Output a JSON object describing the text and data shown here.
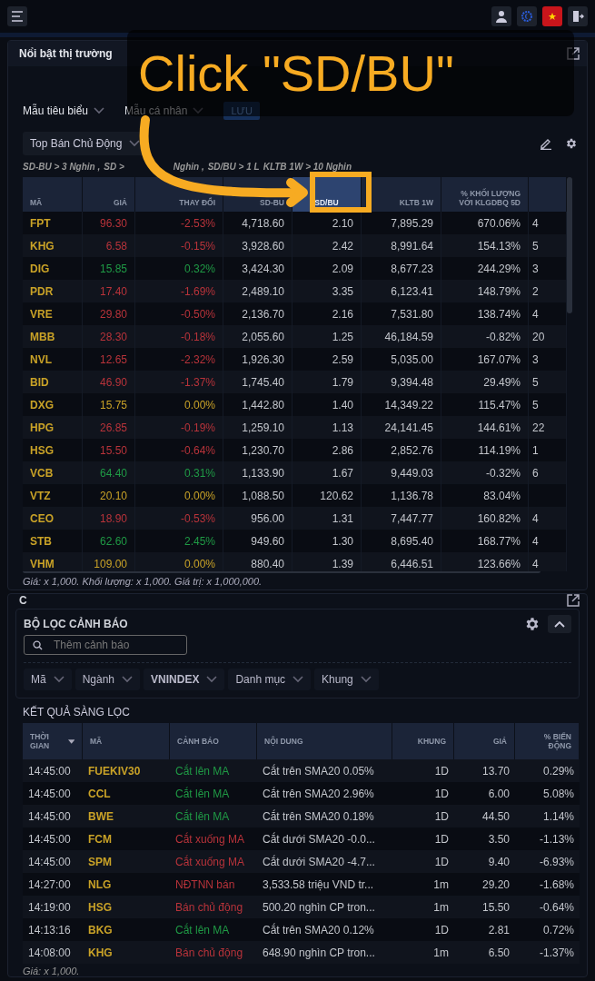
{
  "tutorial": {
    "text": "Click \"SD/BU\""
  },
  "market_panel": {
    "title": "Nổi bật thị trường",
    "templates": [
      "Mẫu tiêu biểu",
      "Mẫu cá nhân"
    ],
    "save_button": "LƯU",
    "screen_select": "Top Bán Chủ Động",
    "criteria": [
      "SD-BU > 3 Nghin ,",
      "SD >",
      "Nghin ,",
      "SD/BU > 1 L",
      "KLTB 1W > 10 Nghin"
    ],
    "columns": [
      {
        "label": "MÃ",
        "highlighted": false
      },
      {
        "label": "GIÁ",
        "highlighted": false
      },
      {
        "label": "THAY ĐỔI",
        "highlighted": false
      },
      {
        "label": "SD-BU",
        "highlighted": false
      },
      {
        "label": "SD/BU",
        "highlighted": true
      },
      {
        "label": "KLTB 1W",
        "highlighted": false
      },
      {
        "label": "% KHỐI LƯỢNG VỚI KLGDBQ 5D",
        "highlighted": false
      },
      {
        "highlighted": false
      }
    ],
    "rows": [
      {
        "symbol": "FPT",
        "price": "96.30",
        "change": "-2.53%",
        "sd_bu": "4,718.60",
        "sd_ratio": "2.10",
        "kltb_1w": "7,895.29",
        "vol_pct": "670.06%",
        "column_8": "4",
        "color": "#b8333a"
      },
      {
        "symbol": "KHG",
        "price": "6.58",
        "change": "-0.15%",
        "sd_bu": "3,928.60",
        "sd_ratio": "2.42",
        "kltb_1w": "8,991.64",
        "vol_pct": "154.13%",
        "column_8": "5",
        "color": "#b8333a"
      },
      {
        "symbol": "DIG",
        "price": "15.85",
        "change": "0.32%",
        "sd_bu": "3,424.30",
        "sd_ratio": "2.09",
        "kltb_1w": "8,677.23",
        "vol_pct": "244.29%",
        "column_8": "3",
        "color": "#1f9a45"
      },
      {
        "symbol": "PDR",
        "price": "17.40",
        "change": "-1.69%",
        "sd_bu": "2,489.10",
        "sd_ratio": "3.35",
        "kltb_1w": "6,123.41",
        "vol_pct": "148.79%",
        "column_8": "2",
        "color": "#b8333a"
      },
      {
        "symbol": "VRE",
        "price": "29.80",
        "change": "-0.50%",
        "sd_bu": "2,136.70",
        "sd_ratio": "2.16",
        "kltb_1w": "7,531.80",
        "vol_pct": "138.74%",
        "column_8": "4",
        "color": "#b8333a"
      },
      {
        "symbol": "MBB",
        "price": "28.30",
        "change": "-0.18%",
        "sd_bu": "2,055.60",
        "sd_ratio": "1.25",
        "kltb_1w": "46,184.59",
        "vol_pct": "-0.82%",
        "column_8": "20",
        "color": "#b8333a"
      },
      {
        "symbol": "NVL",
        "price": "12.65",
        "change": "-2.32%",
        "sd_bu": "1,926.30",
        "sd_ratio": "2.59",
        "kltb_1w": "5,035.00",
        "vol_pct": "167.07%",
        "column_8": "3",
        "color": "#b8333a"
      },
      {
        "symbol": "BID",
        "price": "46.90",
        "change": "-1.37%",
        "sd_bu": "1,745.40",
        "sd_ratio": "1.79",
        "kltb_1w": "9,394.48",
        "vol_pct": "29.49%",
        "column_8": "5",
        "color": "#b8333a"
      },
      {
        "symbol": "DXG",
        "price": "15.75",
        "change": "0.00%",
        "sd_bu": "1,442.80",
        "sd_ratio": "1.40",
        "kltb_1w": "14,349.22",
        "vol_pct": "115.47%",
        "column_8": "5",
        "color": "#c9a227"
      },
      {
        "symbol": "HPG",
        "price": "26.85",
        "change": "-0.19%",
        "sd_bu": "1,259.10",
        "sd_ratio": "1.13",
        "kltb_1w": "24,141.45",
        "vol_pct": "144.61%",
        "column_8": "22",
        "color": "#b8333a"
      },
      {
        "symbol": "HSG",
        "price": "15.50",
        "change": "-0.64%",
        "sd_bu": "1,230.70",
        "sd_ratio": "2.86",
        "kltb_1w": "2,852.76",
        "vol_pct": "114.19%",
        "column_8": "1",
        "color": "#b8333a"
      },
      {
        "symbol": "VCB",
        "price": "64.40",
        "change": "0.31%",
        "sd_bu": "1,133.90",
        "sd_ratio": "1.67",
        "kltb_1w": "9,449.03",
        "vol_pct": "-0.32%",
        "column_8": "6",
        "color": "#1f9a45"
      },
      {
        "symbol": "VTZ",
        "price": "20.10",
        "change": "0.00%",
        "sd_bu": "1,088.50",
        "sd_ratio": "120.62",
        "kltb_1w": "1,136.78",
        "vol_pct": "83.04%",
        "color": "#c9a227"
      },
      {
        "symbol": "CEO",
        "price": "18.90",
        "change": "-0.53%",
        "sd_bu": "956.00",
        "sd_ratio": "1.31",
        "kltb_1w": "7,447.77",
        "vol_pct": "160.82%",
        "column_8": "4",
        "color": "#b8333a"
      },
      {
        "symbol": "STB",
        "price": "62.60",
        "change": "2.45%",
        "sd_bu": "949.60",
        "sd_ratio": "1.30",
        "kltb_1w": "8,695.40",
        "vol_pct": "168.77%",
        "column_8": "4",
        "color": "#1f9a45"
      },
      {
        "symbol": "VHM",
        "price": "109.00",
        "change": "0.00%",
        "sd_bu": "880.40",
        "sd_ratio": "1.39",
        "kltb_1w": "6,446.51",
        "vol_pct": "123.66%",
        "column_8": "4",
        "color": "#c9a227"
      }
    ],
    "footnote": "Giá: x 1,000. Khối lượng: x 1,000. Giá trị: x 1,000,000."
  },
  "alert_panel": {
    "title": "C",
    "filter_title": "BỘ LỌC CẢNH BÁO",
    "search": {
      "placeholder": "Thêm cảnh báo"
    },
    "filters": [
      {
        "label": "Mã",
        "bold": false
      },
      {
        "label": "Ngành",
        "bold": false
      },
      {
        "label": "VNINDEX",
        "bold": true
      },
      {
        "label": "Danh mục",
        "bold": false
      },
      {
        "label": "Khung",
        "bold": false
      }
    ],
    "results_title": "KẾT QUẢ SÀNG LỌC",
    "columns": [
      "THỜI GIAN",
      "MÃ",
      "CẢNH BÁO",
      "NỘI DUNG",
      "KHUNG",
      "GIÁ",
      "% BIẾN ĐỘNG"
    ],
    "rows": [
      {
        "time": "14:45:00",
        "symbol": "FUEKIV30",
        "alert": "Cắt lên MA",
        "color": "#1f9a45",
        "content": "Cắt trên SMA20 0.05%",
        "frame": "1D",
        "price": "13.70",
        "change": "0.29%"
      },
      {
        "time": "14:45:00",
        "symbol": "CCL",
        "alert": "Cắt lên MA",
        "color": "#1f9a45",
        "content": "Cắt trên SMA20 2.96%",
        "frame": "1D",
        "price": "6.00",
        "change": "5.08%"
      },
      {
        "time": "14:45:00",
        "symbol": "BWE",
        "alert": "Cắt lên MA",
        "color": "#1f9a45",
        "content": "Cắt trên SMA20 0.18%",
        "frame": "1D",
        "price": "44.50",
        "change": "1.14%"
      },
      {
        "time": "14:45:00",
        "symbol": "FCM",
        "alert": "Cắt xuống MA",
        "color": "#b8333a",
        "content": "Cắt dưới SMA20 -0.0...",
        "frame": "1D",
        "price": "3.50",
        "change": "-1.13%"
      },
      {
        "time": "14:45:00",
        "symbol": "SPM",
        "alert": "Cắt xuống MA",
        "color": "#b8333a",
        "content": "Cắt dưới SMA20 -4.7...",
        "frame": "1D",
        "price": "9.40",
        "change": "-6.93%"
      },
      {
        "time": "14:27:00",
        "symbol": "NLG",
        "alert": "NĐTNN bán",
        "color": "#b8333a",
        "content": "3,533.58 triệu VND tr...",
        "frame": "1m",
        "price": "29.20",
        "change": "-1.68%"
      },
      {
        "time": "14:19:00",
        "symbol": "HSG",
        "alert": "Bán chủ động",
        "color": "#b8333a",
        "content": "500.20 nghìn CP tron...",
        "frame": "1m",
        "price": "15.50",
        "change": "-0.64%"
      },
      {
        "time": "14:13:16",
        "symbol": "BKG",
        "alert": "Cắt lên MA",
        "color": "#1f9a45",
        "content": "Cắt trên SMA20 0.12%",
        "frame": "1D",
        "price": "2.81",
        "change": "0.72%"
      },
      {
        "time": "14:08:00",
        "symbol": "KHG",
        "alert": "Bán chủ động",
        "color": "#b8333a",
        "content": "648.90 nghìn CP tron...",
        "frame": "1m",
        "price": "6.50",
        "change": "-1.37%"
      }
    ],
    "footnote": "Giá: x 1,000."
  }
}
